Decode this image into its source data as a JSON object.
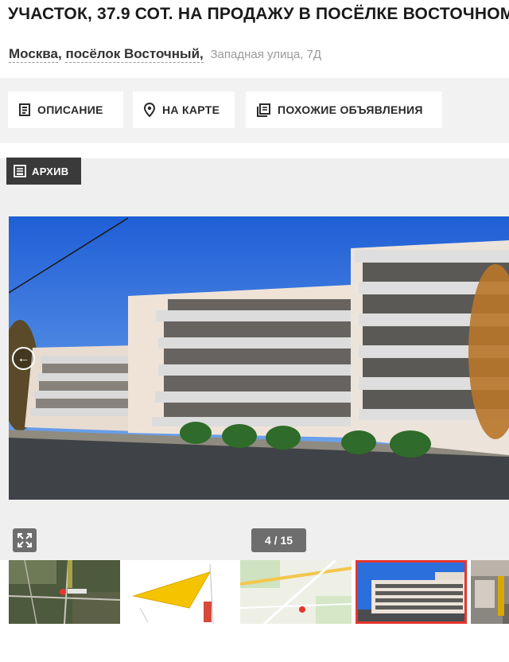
{
  "listing": {
    "title": "УЧАСТОК, 37.9 СОТ. НА ПРОДАЖУ В ПОСЁЛКЕ ВОСТОЧНОМ",
    "address": {
      "city": "Москва",
      "separator": ",",
      "settlement": "посёлок Восточный,",
      "street": "Западная улица, 7Д"
    }
  },
  "tabs": [
    {
      "label": "ОПИСАНИЕ",
      "icon": "document-icon"
    },
    {
      "label": "НА КАРТЕ",
      "icon": "map-pin-icon"
    },
    {
      "label": "ПОХОЖИЕ ОБЪЯВЛЕНИЯ",
      "icon": "copy-list-icon"
    }
  ],
  "gallery": {
    "archive_badge": "АРХИВ",
    "counter": "4 / 15",
    "current_index": 4,
    "total": 15,
    "prev_icon": "arrow-left-icon",
    "fullscreen_icon": "expand-icon",
    "thumbnails": [
      {
        "kind": "satellite-map"
      },
      {
        "kind": "plot-plan"
      },
      {
        "kind": "street-map"
      },
      {
        "kind": "building-photo",
        "active": true
      },
      {
        "kind": "interior-photo"
      }
    ]
  },
  "colors": {
    "accent": "#e5362f",
    "tab_bar": "#f2f2f2",
    "badge": "#3a3a3a",
    "counter": "#6e6e6e"
  }
}
